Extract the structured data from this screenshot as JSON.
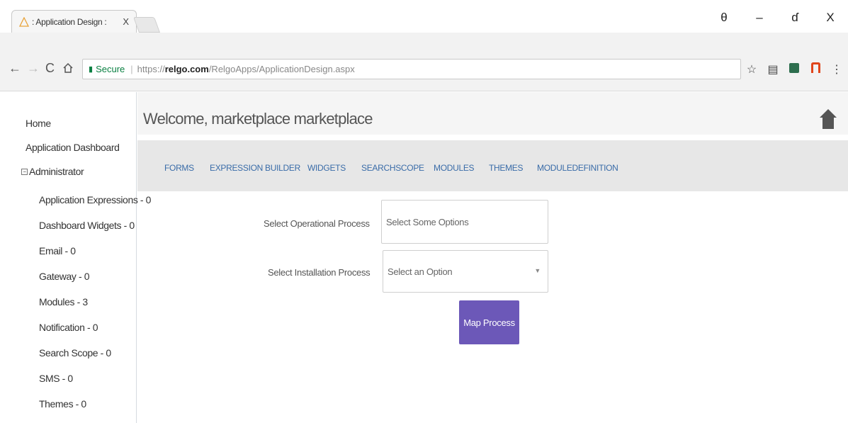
{
  "browser": {
    "tab_title": ": Application Design :",
    "tab_close": "X",
    "window_controls": {
      "profile": "θ",
      "minimize": "–",
      "restore": "ɗ",
      "close": "X"
    },
    "secure_label": "Secure",
    "url_scheme": "https://",
    "url_host": "relgo.com",
    "url_path": "/RelgoApps/ApplicationDesign.aspx"
  },
  "sidebar": {
    "home": "Home",
    "dashboard": "Application Dashboard",
    "admin_expander": "⊟",
    "administrator": "Administrator",
    "items": [
      "Application Expressions - 0",
      "Dashboard Widgets - 0",
      "Email - 0",
      "Gateway - 0",
      "Modules - 3",
      "Notification - 0",
      "Search Scope - 0",
      "SMS - 0",
      "Themes - 0"
    ]
  },
  "header": {
    "welcome": "Welcome, marketplace marketplace",
    "home_icon": "home-icon"
  },
  "nav_tabs": [
    "FORMS",
    "EXPRESSION BUILDER",
    "WIDGETS",
    "SEARCHSCOPE",
    "MODULES",
    "THEMES",
    "MODULEDEFINITION"
  ],
  "form": {
    "operational_label": "Select Operational Process",
    "operational_placeholder": "Select Some Options",
    "installation_label": "Select Installation Process",
    "installation_value": "Select an Option",
    "map_button": "Map Process"
  },
  "colors": {
    "accent_button": "#6c58b8",
    "tab_link": "#3a6ca8",
    "secure_green": "#0b8043"
  }
}
